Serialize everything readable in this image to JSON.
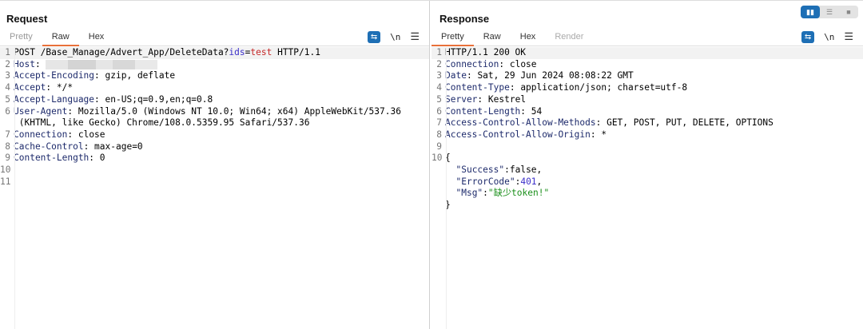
{
  "view_toggle": {
    "icons": [
      "split-horizontal-icon",
      "split-vertical-icon",
      "single-pane-icon"
    ],
    "active": 0
  },
  "request": {
    "title": "Request",
    "tabs": [
      "Pretty",
      "Raw",
      "Hex"
    ],
    "active_tab": "Raw",
    "tools": {
      "wrap_icon": "wrap-lines-icon",
      "newline_label": "\\n",
      "menu_icon": "hamburger-menu-icon"
    },
    "lines": {
      "l1": {
        "method": "POST /Base_Manage/Advert_App/DeleteData?",
        "param": "ids",
        "eq": "=",
        "value": "test",
        "rest": " HTTP/1.1"
      },
      "l2": {
        "key": "Host",
        "sep": ": "
      },
      "l3": {
        "key": "Accept-Encoding",
        "sep": ": ",
        "value": "gzip, deflate"
      },
      "l4": {
        "key": "Accept",
        "sep": ": ",
        "value": "*/*"
      },
      "l5": {
        "key": "Accept-Language",
        "sep": ": ",
        "value": "en-US;q=0.9,en;q=0.8"
      },
      "l6": {
        "key": "User-Agent",
        "sep": ": ",
        "value": "Mozilla/5.0 (Windows NT 10.0; Win64; x64) AppleWebKit/537.36",
        "wrap": " (KHTML, like Gecko) Chrome/108.0.5359.95 Safari/537.36"
      },
      "l7": {
        "key": "Connection",
        "sep": ": ",
        "value": "close"
      },
      "l8": {
        "key": "Cache-Control",
        "sep": ": ",
        "value": "max-age=0"
      },
      "l9": {
        "key": "Content-Length",
        "sep": ": ",
        "value": "0"
      }
    },
    "line_numbers": [
      "1",
      "2",
      "3",
      "4",
      "5",
      "6",
      "7",
      "8",
      "9",
      "10",
      "11"
    ]
  },
  "response": {
    "title": "Response",
    "tabs": [
      "Pretty",
      "Raw",
      "Hex",
      "Render"
    ],
    "active_tab": "Pretty",
    "tools": {
      "wrap_icon": "wrap-lines-icon",
      "newline_label": "\\n",
      "menu_icon": "hamburger-menu-icon"
    },
    "status_line": "HTTP/1.1 200 OK",
    "headers": [
      {
        "key": "Connection",
        "value": "close"
      },
      {
        "key": "Date",
        "value": "Sat, 29 Jun 2024 08:08:22 GMT"
      },
      {
        "key": "Content-Type",
        "value": "application/json; charset=utf-8"
      },
      {
        "key": "Server",
        "value": "Kestrel"
      },
      {
        "key": "Content-Length",
        "value": "54"
      },
      {
        "key": "Access-Control-Allow-Methods",
        "value": "GET, POST, PUT, DELETE, OPTIONS"
      },
      {
        "key": "Access-Control-Allow-Origin",
        "value": "*"
      }
    ],
    "sep": ": ",
    "body": {
      "open": "{",
      "close": "}",
      "success_key": "\"Success\"",
      "success_val": "false",
      "code_key": "\"ErrorCode\"",
      "code_val": "401",
      "msg_key": "\"Msg\"",
      "msg_val": "\"缺少token!\"",
      "colon": ":",
      "comma": ","
    },
    "line_numbers": [
      "1",
      "2",
      "3",
      "4",
      "5",
      "6",
      "7",
      "8",
      "9",
      "10"
    ]
  }
}
